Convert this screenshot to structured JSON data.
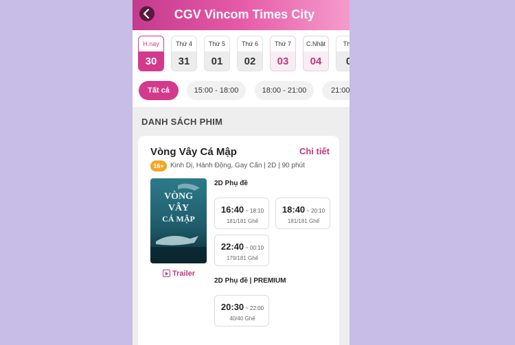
{
  "header": {
    "title": "CGV Vincom Times City"
  },
  "dates": [
    {
      "label": "H.nay",
      "day": "30",
      "state": "active"
    },
    {
      "label": "Thứ 4",
      "day": "31",
      "state": "normal"
    },
    {
      "label": "Thứ 5",
      "day": "01",
      "state": "normal"
    },
    {
      "label": "Thứ 6",
      "day": "02",
      "state": "normal"
    },
    {
      "label": "Thứ 7",
      "day": "03",
      "state": "weekend"
    },
    {
      "label": "C.Nhật",
      "day": "04",
      "state": "weekend"
    },
    {
      "label": "Thứ",
      "day": "0",
      "state": "normal"
    }
  ],
  "time_filters": [
    "Tất cả",
    "15:00 - 18:00",
    "18:00 - 21:00",
    "21:00"
  ],
  "section_title": "DANH SÁCH PHIM",
  "movie": {
    "title": "Vòng Vây Cá Mập",
    "detail_link": "Chi tiết",
    "age_rating": "16+",
    "info": "Kinh Dị, Hành Động, Gay Cấn | 2D | 90 phút",
    "poster_text": [
      "VÒNG",
      "VÂY",
      "CÁ MẬP"
    ],
    "trailer_label": "Trailer",
    "formats": [
      {
        "label": "2D Phụ đề",
        "showtimes": [
          {
            "start": "16:40",
            "end": "~ 18:10",
            "seats": "181/181 Ghế"
          },
          {
            "start": "18:40",
            "end": "~ 20:10",
            "seats": "181/181 Ghế"
          },
          {
            "start": "22:40",
            "end": "~ 00:10",
            "seats": "179/181 Ghế"
          }
        ]
      },
      {
        "label": "2D Phụ đề | PREMIUM",
        "showtimes": [
          {
            "start": "20:30",
            "end": "~ 22:00",
            "seats": "40/40 Ghế"
          }
        ]
      }
    ]
  },
  "colors": {
    "accent": "#d33a8b",
    "badge": "#f2a623",
    "background": "#c7bde6"
  }
}
